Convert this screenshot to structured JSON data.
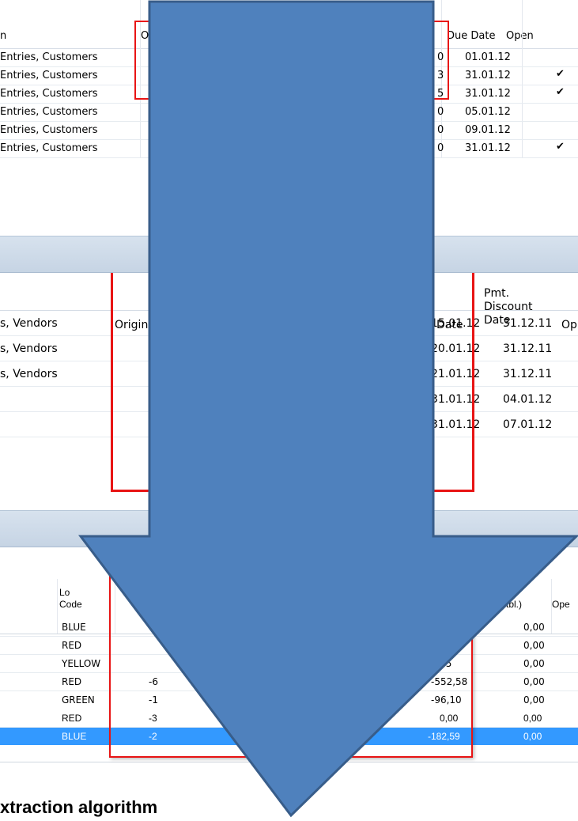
{
  "panel1": {
    "headers": {
      "description": "n",
      "original_partial": "O",
      "due_date": "Due Date",
      "open": "Open"
    },
    "rows": [
      {
        "description": "Entries, Customers",
        "amount_tail": "0",
        "due_date": "01.01.12",
        "open": ""
      },
      {
        "description": "Entries, Customers",
        "amount_tail": "3",
        "due_date": "31.01.12",
        "open": "✔"
      },
      {
        "description": "Entries, Customers",
        "amount_tail": "5",
        "due_date": "31.01.12",
        "open": "✔"
      },
      {
        "description": "Entries, Customers",
        "amount_tail": "0",
        "due_date": "05.01.12",
        "open": ""
      },
      {
        "description": "Entries, Customers",
        "amount_tail": "0",
        "due_date": "09.01.12",
        "open": ""
      },
      {
        "description": "Entries, Customers",
        "amount_tail": "0",
        "due_date": "31.01.12",
        "open": "✔"
      }
    ]
  },
  "panel2": {
    "headers": {
      "original": "Origina",
      "due_date": "Date",
      "pmt_discount_date": "Pmt.\nDiscount\nDate",
      "open": "Op"
    },
    "rows": [
      {
        "description": "s, Vendors",
        "amount_tail": "-",
        "due_date": "15.01.12",
        "pmt_date": "31.12.11"
      },
      {
        "description": "s, Vendors",
        "amount_tail": "-",
        "due_date": "20.01.12",
        "pmt_date": "31.12.11"
      },
      {
        "description": "s, Vendors",
        "amount_tail": "-",
        "due_date": "21.01.12",
        "pmt_date": "31.12.11"
      },
      {
        "description": "",
        "amount_tail": "",
        "due_date": "31.01.12",
        "pmt_date": "04.01.12"
      },
      {
        "description": "",
        "amount_tail": "",
        "due_date": "31.01.12",
        "pmt_date": "07.01.12"
      }
    ]
  },
  "panel3": {
    "headers": {
      "location": "Lo\nCode",
      "amount": "ount\n(Invtbl.)",
      "open": "Ope"
    },
    "rows": [
      {
        "location": "BLUE",
        "qty": "",
        "cost": "",
        "discount": "0,00",
        "selected": false
      },
      {
        "location": "RED",
        "qty": "",
        "cost": "",
        "discount": "0,00",
        "selected": false
      },
      {
        "location": "YELLOW",
        "qty": "",
        "cost": "-,55",
        "discount": "0,00",
        "selected": false
      },
      {
        "location": "RED",
        "qty": "-6",
        "cost": "-552,58",
        "discount": "0,00",
        "selected": false
      },
      {
        "location": "GREEN",
        "qty": "-1",
        "cost": "-96,10",
        "discount": "0,00",
        "selected": false
      },
      {
        "location": "RED",
        "qty": "-3",
        "cost": "0,00",
        "discount": "0,00",
        "selected": false
      },
      {
        "location": "BLUE",
        "qty": "-2",
        "cost": "-182,59",
        "discount": "0,00",
        "selected": true
      }
    ]
  },
  "footer": {
    "caption": "xtraction algorithm"
  },
  "colors": {
    "arrow_fill": "#4f81bd",
    "arrow_stroke": "#385d8a",
    "highlight_box": "#e81414",
    "selection": "#3399ff"
  }
}
